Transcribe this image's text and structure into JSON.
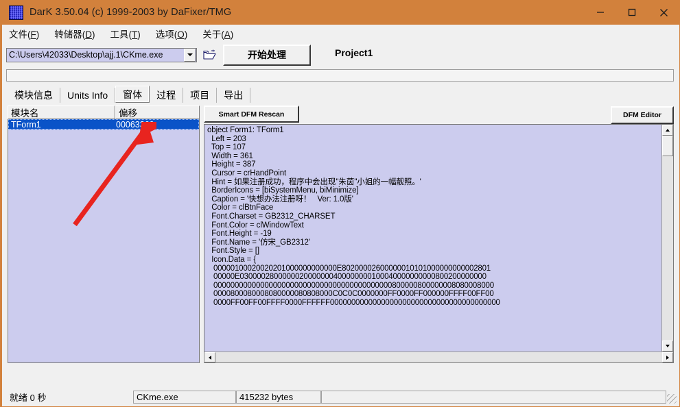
{
  "window": {
    "title": "DarK 3.50.04 (c) 1999-2003 by DaFixer/TMG",
    "icon": "app-grid-icon",
    "minimize": "—",
    "maximize": "□",
    "close": "✕",
    "titlebar_color": "#d2813c"
  },
  "menu": [
    {
      "label": "文件",
      "accel": "F"
    },
    {
      "label": "转储器",
      "accel": "D"
    },
    {
      "label": "工具",
      "accel": "T"
    },
    {
      "label": "选项",
      "accel": "O"
    },
    {
      "label": "关于",
      "accel": "A"
    }
  ],
  "toolbar": {
    "path_value": "C:\\Users\\42033\\Desktop\\ajj.1\\CKme.exe",
    "dropdown_icon": "chevron-down-icon",
    "open_icon": "open-folder-icon",
    "start_label": "开始处理",
    "project_name": "Project1"
  },
  "tabs": [
    {
      "label": "模块信息",
      "selected": false
    },
    {
      "label": "Units Info",
      "selected": false
    },
    {
      "label": "窗体",
      "selected": true
    },
    {
      "label": "过程",
      "selected": false
    },
    {
      "label": "项目",
      "selected": false
    },
    {
      "label": "导出",
      "selected": false
    }
  ],
  "list": {
    "columns": [
      "模块名",
      "偏移"
    ],
    "rows": [
      {
        "name": "TForm1",
        "offset": "00063360",
        "selected": true
      }
    ]
  },
  "right_panel": {
    "rescan_label": "Smart DFM Rescan",
    "dfm_editor_label": "DFM Editor",
    "dfm_text": "object Form1: TForm1\n  Left = 203\n  Top = 107\n  Width = 361\n  Height = 387\n  Cursor = crHandPoint\n  Hint = 如果注册成功，程序中会出现''朱茵''小姐的一幅靓照。'\n  BorderIcons = [biSystemMenu, biMinimize]\n  Caption = '快想办法注册呀！   Ver: 1.0版'\n  Color = clBtnFace\n  Font.Charset = GB2312_CHARSET\n  Font.Color = clWindowText\n  Font.Height = -19\n  Font.Name = '仿宋_GB2312'\n  Font.Style = []\n  Icon.Data = {",
    "hex_lines": [
      "00000100020020201000000000000E80200002600000010101000000000002801",
      "00000E0300002800000020000000400000000100040000000000800200000000",
      "000000000000000000000000000000000000000000800000800000008080008000",
      "0000800080008080000080808000C0C0C0000000FF0000FF000000FFFF00FF00",
      "0000FF00FF00FFFF0000FFFFFF0000000000000000000000000000000000000000"
    ],
    "scroll_up_icon": "arrow-up-icon",
    "scroll_down_icon": "arrow-down-icon",
    "scroll_left_icon": "arrow-left-icon",
    "scroll_right_icon": "arrow-right-icon"
  },
  "statusbar": {
    "ready": "就绪 0 秒",
    "file": "CKme.exe",
    "size": "415232 bytes",
    "extra": ""
  },
  "annotation": {
    "arrow_color": "#e8241f",
    "name": "red-arrow-pointing-to-tform1"
  }
}
